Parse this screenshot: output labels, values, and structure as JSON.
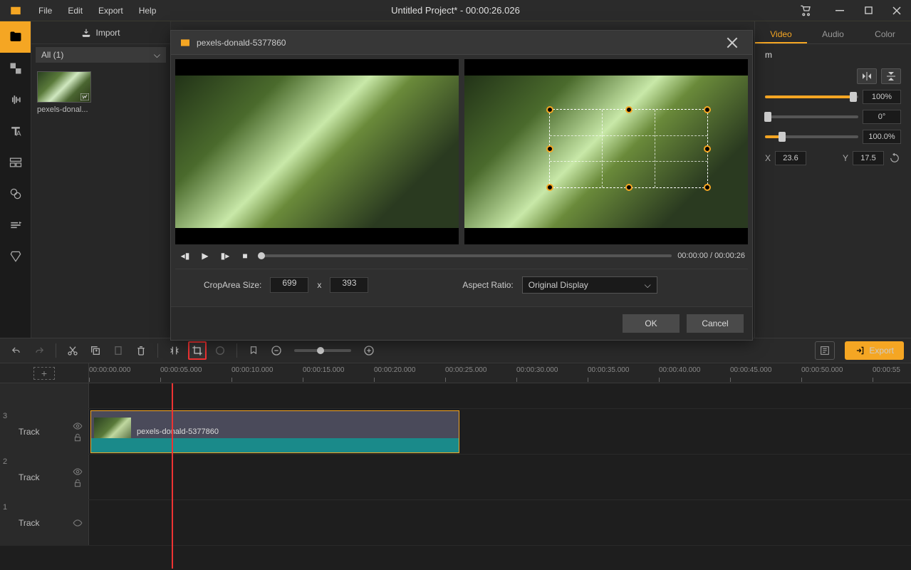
{
  "title": "Untitled Project* - 00:00:26.026",
  "menu": {
    "file": "File",
    "edit": "Edit",
    "export": "Export",
    "help": "Help"
  },
  "import_label": "Import",
  "filter": {
    "label": "All (1)"
  },
  "thumb": {
    "name": "pexels-donal..."
  },
  "dialog": {
    "title": "pexels-donald-5377860",
    "time": "00:00:00 / 00:00:26",
    "crop_label": "CropArea Size:",
    "crop_w": "699",
    "crop_x": "x",
    "crop_h": "393",
    "aspect_label": "Aspect Ratio:",
    "aspect_val": "Original Display",
    "ok": "OK",
    "cancel": "Cancel"
  },
  "props": {
    "tab_video": "Video",
    "tab_audio": "Audio",
    "tab_color": "Color",
    "sub": "m",
    "v1": "100%",
    "v2": "0°",
    "v3": "100.0%",
    "x_label": "X",
    "x_val": "23.6",
    "y_label": "Y",
    "y_val": "17.5"
  },
  "export_btn": "Export",
  "timeline": {
    "ticks": [
      "00:00:00.000",
      "00:00:05.000",
      "00:00:10.000",
      "00:00:15.000",
      "00:00:20.000",
      "00:00:25.000",
      "00:00:30.000",
      "00:00:35.000",
      "00:00:40.000",
      "00:00:45.000",
      "00:00:50.000",
      "00:00:55"
    ],
    "track_label": "Track",
    "t3": "3",
    "t2": "2",
    "t1": "1",
    "clip_label": "pexels-donald-5377860"
  }
}
